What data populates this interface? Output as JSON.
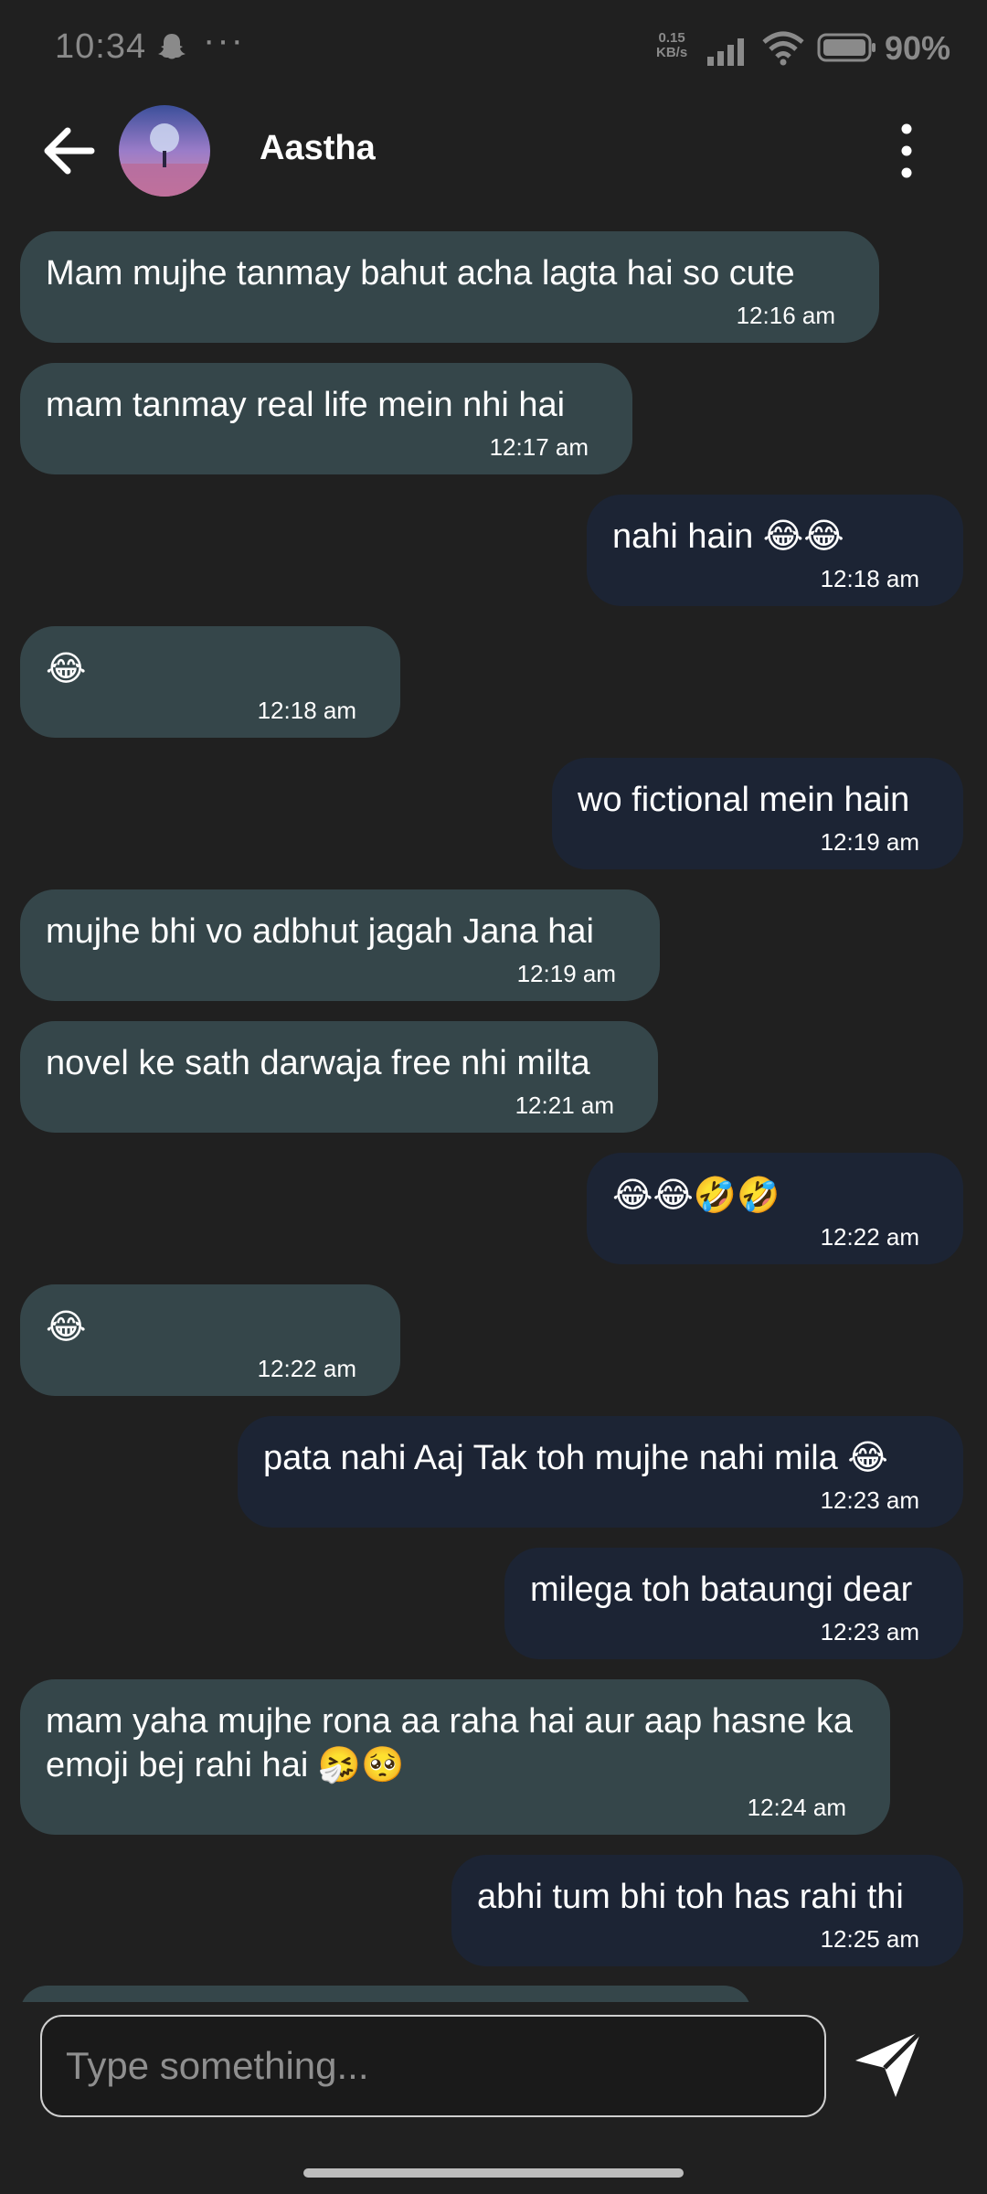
{
  "status_bar": {
    "time": "10:34",
    "dots": "···",
    "speed_value": "0.15",
    "speed_unit": "KB/s",
    "battery": "90%"
  },
  "header": {
    "contact_name": "Aastha"
  },
  "messages": [
    {
      "direction": "in",
      "text": "Mam mujhe tanmay bahut acha lagta hai so cute",
      "time": "12:16 am"
    },
    {
      "direction": "in",
      "text": "mam tanmay real life mein nhi hai",
      "time": "12:17 am"
    },
    {
      "direction": "out",
      "text": "nahi hain 😂😂",
      "time": "12:18 am"
    },
    {
      "direction": "in",
      "text": "😂",
      "time": "12:18 am"
    },
    {
      "direction": "out",
      "text": "wo fictional mein hain",
      "time": "12:19 am"
    },
    {
      "direction": "in",
      "text": "mujhe bhi vo adbhut jagah Jana hai",
      "time": "12:19 am"
    },
    {
      "direction": "in",
      "text": "novel ke sath darwaja free nhi milta",
      "time": "12:21 am"
    },
    {
      "direction": "out",
      "text": "😂😂🤣🤣",
      "time": "12:22 am"
    },
    {
      "direction": "in",
      "text": "😂",
      "time": "12:22 am"
    },
    {
      "direction": "out",
      "text": "pata nahi Aaj Tak toh mujhe nahi mila 😂",
      "time": "12:23 am"
    },
    {
      "direction": "out",
      "text": "milega toh bataungi dear",
      "time": "12:23 am"
    },
    {
      "direction": "in",
      "text": "mam yaha mujhe rona aa raha hai aur aap hasne ka emoji bej rahi hai 🤧🥺",
      "time": "12:24 am"
    },
    {
      "direction": "out",
      "text": "abhi tum bhi toh has rahi thi",
      "time": "12:25 am"
    }
  ],
  "composer": {
    "placeholder": "Type something..."
  },
  "colors": {
    "background": "#202020",
    "incoming_bubble": "#35464a",
    "outgoing_bubble": "#1c2434"
  },
  "icons": {
    "back": "arrow-left-icon",
    "more": "more-vertical-icon",
    "send": "send-icon"
  }
}
